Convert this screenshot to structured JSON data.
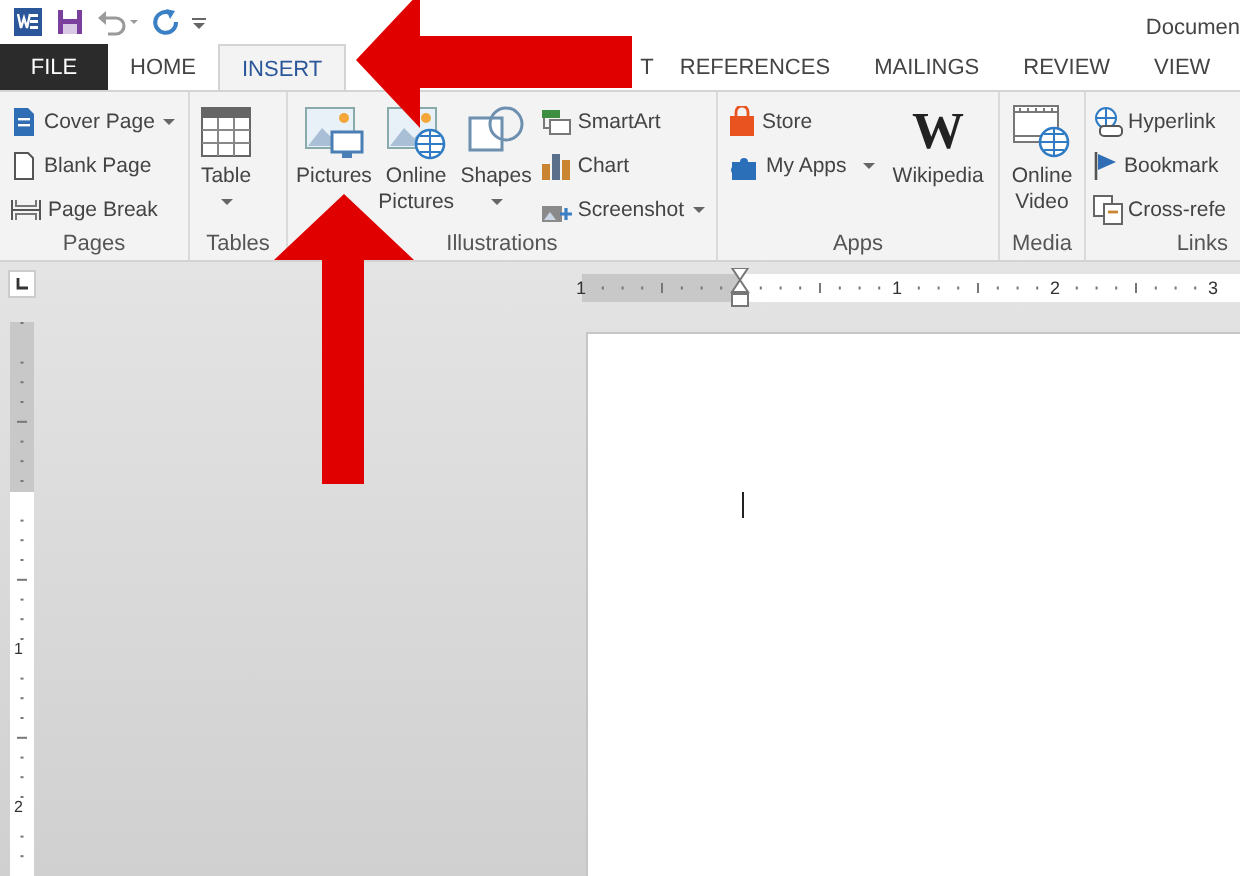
{
  "title_bar": {
    "document_title": "Documen"
  },
  "tabs": [
    {
      "label": "FILE",
      "selected": false,
      "kind": "file"
    },
    {
      "label": "HOME",
      "selected": false,
      "kind": "tab"
    },
    {
      "label": "INSERT",
      "selected": true,
      "kind": "tab"
    },
    {
      "label": "T",
      "selected": false,
      "kind": "covered"
    },
    {
      "label": "REFERENCES",
      "selected": false,
      "kind": "tab"
    },
    {
      "label": "MAILINGS",
      "selected": false,
      "kind": "tab"
    },
    {
      "label": "REVIEW",
      "selected": false,
      "kind": "tab"
    },
    {
      "label": "VIEW",
      "selected": false,
      "kind": "tab"
    }
  ],
  "ribbon_groups": [
    {
      "label": "Pages",
      "commands": [
        {
          "label": "Cover Page",
          "kind": "small",
          "dropdown": true
        },
        {
          "label": "Blank Page",
          "kind": "small",
          "dropdown": false
        },
        {
          "label": "Page Break",
          "kind": "small",
          "dropdown": false
        }
      ]
    },
    {
      "label": "Tables",
      "commands": [
        {
          "label": "Table",
          "kind": "large",
          "dropdown": true
        }
      ]
    },
    {
      "label": "Illustrations",
      "commands": [
        {
          "label": "Pictures",
          "kind": "large",
          "dropdown": false
        },
        {
          "label": "Online Pictures",
          "kind": "large",
          "dropdown": false
        },
        {
          "label": "Shapes",
          "kind": "large",
          "dropdown": true
        },
        {
          "label": "SmartArt",
          "kind": "small",
          "dropdown": false
        },
        {
          "label": "Chart",
          "kind": "small",
          "dropdown": false
        },
        {
          "label": "Screenshot",
          "kind": "small",
          "dropdown": true
        }
      ]
    },
    {
      "label": "Apps",
      "commands": [
        {
          "label": "Store",
          "kind": "small",
          "dropdown": false
        },
        {
          "label": "My Apps",
          "kind": "small",
          "dropdown": true
        },
        {
          "label": "Wikipedia",
          "kind": "large",
          "dropdown": false,
          "glyph": "W"
        }
      ]
    },
    {
      "label": "Media",
      "commands": [
        {
          "label": "Online Video",
          "kind": "large",
          "dropdown": false
        }
      ]
    },
    {
      "label": "Links",
      "commands": [
        {
          "label": "Hyperlink",
          "kind": "small",
          "dropdown": false
        },
        {
          "label": "Bookmark",
          "kind": "small",
          "dropdown": false
        },
        {
          "label": "Cross-refe",
          "kind": "small",
          "dropdown": false
        }
      ]
    }
  ],
  "rulers": {
    "horizontal": [
      "1",
      "1",
      "2",
      "3"
    ],
    "vertical": [
      "1",
      "2"
    ]
  }
}
